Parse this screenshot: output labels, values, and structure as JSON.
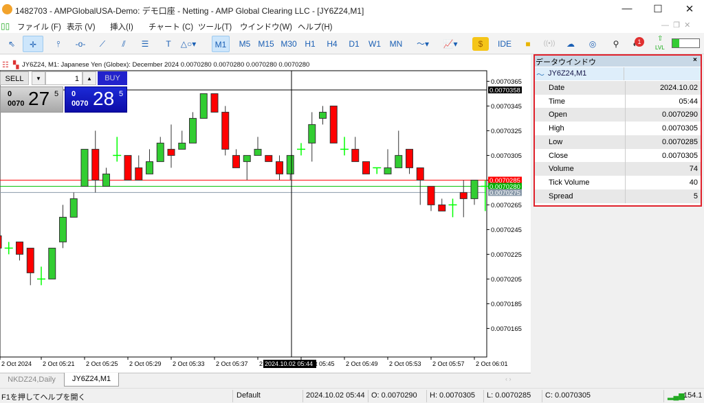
{
  "window": {
    "title": "1482703 - AMPGlobalUSA-Demo: デモ口座 - Netting - AMP Global Clearing LLC - [JY6Z24,M1]",
    "minimize": "—",
    "maximize": "☐",
    "close": "✕"
  },
  "menu": [
    "ファイル (F)",
    "表示 (V)",
    "挿入(I)",
    "チャート (C)",
    "ツール(T)",
    "ウインドウ(W)",
    "ヘルプ(H)"
  ],
  "toolbar": {
    "timeframes": [
      "M1",
      "M5",
      "M15",
      "M30",
      "H1",
      "H4",
      "D1",
      "W1",
      "MN"
    ],
    "selected_timeframe": "M1",
    "ide": "IDE",
    "notification_count": "1",
    "lvl": "LVL"
  },
  "chart": {
    "info": "JY6Z24, M1:  Japanese Yen (Globex): December 2024  0.0070280 0.0070280 0.0070280 0.0070280",
    "sell_label": "SELL",
    "buy_label": "BUY",
    "volume": "1",
    "bid": {
      "prefix_top": "0",
      "prefix_bot": "0070",
      "big": "27",
      "sup": "5"
    },
    "ask": {
      "prefix_top": "0",
      "prefix_bot": "0070",
      "big": "28",
      "sup": "5"
    },
    "crosshair_price": "0.0070358",
    "crosshair_time": "2024.10.02 05:44",
    "price_labels": {
      "red": "0.0070285",
      "green": "0.0070280",
      "gray": "0.0070275"
    },
    "colors": {
      "bull": "#32cd32",
      "bear": "#ff0000",
      "doji": "#00ff00",
      "ask_line": "#ff0000",
      "last_line": "#00c000",
      "bid_line": "#8a9aaa"
    }
  },
  "chart_data": {
    "type": "candlestick",
    "yticks": [
      "0.0070365",
      "0.0070345",
      "0.0070325",
      "0.0070305",
      "0.0070285",
      "0.0070265",
      "0.0070245",
      "0.0070225",
      "0.0070205",
      "0.0070185",
      "0.0070165"
    ],
    "xticks": [
      "2 Oct 2024",
      "2 Oct 05:21",
      "2 Oct 05:25",
      "2 Oct 05:29",
      "2 Oct 05:33",
      "2 Oct 05:37",
      "2 Oct 05:41",
      "2 Oct 05:45",
      "2 Oct 05:49",
      "2 Oct 05:53",
      "2 Oct 05:57",
      "2 Oct 06:01"
    ],
    "first_time": "05:17",
    "ohlc": [
      [
        0.007024,
        0.007024,
        0.007023,
        0.007023
      ],
      [
        0.007023,
        0.0070235,
        0.0070225,
        0.007023
      ],
      [
        0.0070235,
        0.0070235,
        0.007022,
        0.0070225
      ],
      [
        0.007023,
        0.007023,
        0.00702,
        0.007021
      ],
      [
        0.0070205,
        0.0070215,
        0.00702,
        0.0070205
      ],
      [
        0.0070205,
        0.007023,
        0.0070205,
        0.007023
      ],
      [
        0.0070235,
        0.0070265,
        0.007023,
        0.0070255
      ],
      [
        0.0070255,
        0.0070275,
        0.0070255,
        0.007027
      ],
      [
        0.007028,
        0.007031,
        0.007028,
        0.007031
      ],
      [
        0.007031,
        0.0070325,
        0.0070275,
        0.0070285
      ],
      [
        0.007028,
        0.0070295,
        0.007028,
        0.007029
      ],
      [
        0.0070305,
        0.007032,
        0.00703,
        0.0070305
      ],
      [
        0.0070305,
        0.0070305,
        0.0070285,
        0.0070285
      ],
      [
        0.0070295,
        0.0070305,
        0.0070285,
        0.0070285
      ],
      [
        0.007029,
        0.007031,
        0.007029,
        0.00703
      ],
      [
        0.00703,
        0.007032,
        0.00703,
        0.0070315
      ],
      [
        0.007031,
        0.007033,
        0.0070295,
        0.0070305
      ],
      [
        0.007031,
        0.0070325,
        0.007031,
        0.0070315
      ],
      [
        0.0070315,
        0.007034,
        0.0070315,
        0.0070335
      ],
      [
        0.0070335,
        0.0070355,
        0.0070335,
        0.0070355
      ],
      [
        0.0070355,
        0.0070355,
        0.007034,
        0.007034
      ],
      [
        0.007034,
        0.0070345,
        0.0070305,
        0.007031
      ],
      [
        0.0070305,
        0.007031,
        0.0070295,
        0.0070295
      ],
      [
        0.00703,
        0.0070305,
        0.0070285,
        0.0070305
      ],
      [
        0.0070305,
        0.007032,
        0.0070305,
        0.007031
      ],
      [
        0.0070305,
        0.0070305,
        0.00703,
        0.00703
      ],
      [
        0.00703,
        0.0070305,
        0.0070285,
        0.007029
      ],
      [
        0.007029,
        0.0070305,
        0.0070285,
        0.0070305
      ],
      [
        0.007031,
        0.0070315,
        0.0070305,
        0.007031
      ],
      [
        0.0070315,
        0.007034,
        0.00703,
        0.007033
      ],
      [
        0.0070335,
        0.0070345,
        0.007033,
        0.007034
      ],
      [
        0.0070345,
        0.0070345,
        0.0070315,
        0.0070315
      ],
      [
        0.007031,
        0.007032,
        0.0070305,
        0.007031
      ],
      [
        0.007031,
        0.007032,
        0.00703,
        0.00703
      ],
      [
        0.00703,
        0.00703,
        0.007029,
        0.007029
      ],
      [
        0.0070295,
        0.0070295,
        0.007029,
        0.0070295
      ],
      [
        0.007029,
        0.007031,
        0.007029,
        0.0070295
      ],
      [
        0.0070295,
        0.0070325,
        0.0070295,
        0.0070305
      ],
      [
        0.007031,
        0.007031,
        0.007029,
        0.0070295
      ],
      [
        0.0070295,
        0.0070295,
        0.0070265,
        0.0070285
      ],
      [
        0.007028,
        0.007028,
        0.007026,
        0.0070265
      ],
      [
        0.0070265,
        0.007027,
        0.007026,
        0.007026
      ],
      [
        0.0070265,
        0.007027,
        0.0070255,
        0.0070265
      ],
      [
        0.0070275,
        0.0070285,
        0.0070255,
        0.007027
      ],
      [
        0.007027,
        0.0070285,
        0.0070265,
        0.0070285
      ],
      [
        0.007028,
        0.0070285,
        0.007026,
        0.007028
      ]
    ]
  },
  "data_window": {
    "title": "データウインドウ",
    "symbol": "JY6Z24,M1",
    "rows": [
      {
        "k": "Date",
        "v": "2024.10.02"
      },
      {
        "k": "Time",
        "v": "05:44"
      },
      {
        "k": "Open",
        "v": "0.0070290"
      },
      {
        "k": "High",
        "v": "0.0070305"
      },
      {
        "k": "Low",
        "v": "0.0070285"
      },
      {
        "k": "Close",
        "v": "0.0070305"
      },
      {
        "k": "Volume",
        "v": "74"
      },
      {
        "k": "Tick Volume",
        "v": "40"
      },
      {
        "k": "Spread",
        "v": "5"
      }
    ]
  },
  "tabs": [
    {
      "label": "NKDZ24,Daily",
      "active": false
    },
    {
      "label": "JY6Z24,M1",
      "active": true
    }
  ],
  "status": {
    "help": "F1を押してヘルプを開く",
    "profile": "Default",
    "datetime": "2024.10.02 05:44",
    "open": "O: 0.0070290",
    "high": "H: 0.0070305",
    "low": "L: 0.0070285",
    "close": "C: 0.0070305",
    "ping": "154.1"
  }
}
